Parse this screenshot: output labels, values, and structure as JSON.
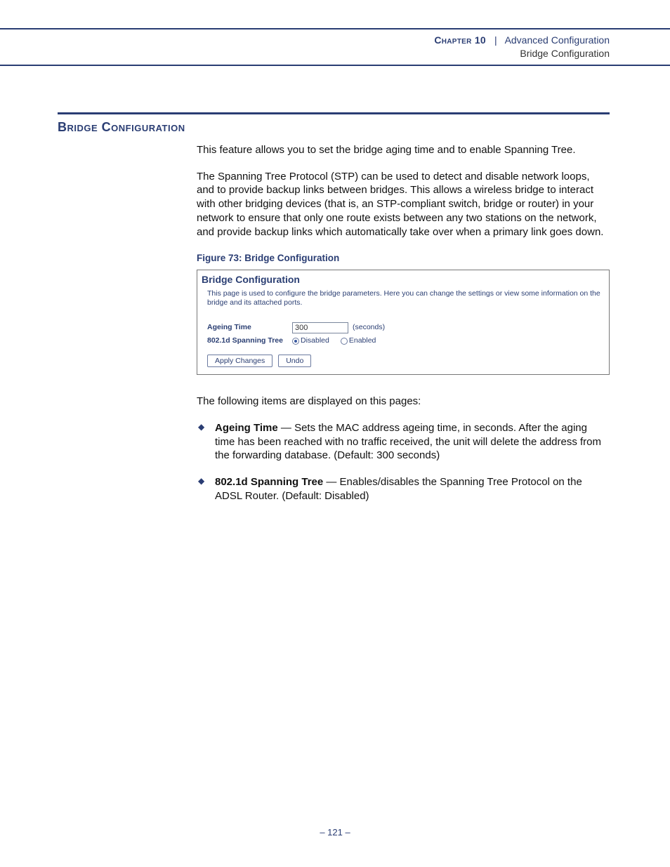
{
  "header": {
    "chapter_word": "Chapter",
    "chapter_num": "10",
    "separator": "|",
    "line1_tail": "Advanced Configuration",
    "line2": "Bridge Configuration"
  },
  "section": {
    "title": "Bridge Configuration",
    "para1": "This feature allows you to set the bridge aging time and to enable Spanning Tree.",
    "para2": "The Spanning Tree Protocol (STP) can be used to detect and disable network loops, and to provide backup links between bridges. This allows a wireless bridge to interact with other bridging devices (that is, an STP-compliant switch, bridge or router) in your network to ensure that only one route exists between any two stations on the network, and provide backup links which automatically take over when a primary link goes down.",
    "figure_caption": "Figure 73:  Bridge Configuration",
    "items_intro": "The following items are displayed on this pages:",
    "bullets": [
      {
        "term": "Ageing Time",
        "desc": " — Sets the MAC address ageing time, in seconds. After the aging time has been reached with no traffic received, the unit will delete the address from the forwarding database. (Default: 300 seconds)"
      },
      {
        "term": "802.1d Spanning Tree",
        "desc": " — Enables/disables the Spanning Tree Protocol on the ADSL Router. (Default: Disabled)"
      }
    ]
  },
  "figure": {
    "title": "Bridge Configuration",
    "desc": "This page is used to configure the bridge parameters. Here you can change the settings or view some information on the bridge and its attached ports.",
    "ageing_label": "Ageing Time",
    "ageing_value": "300",
    "ageing_unit": "(seconds)",
    "stp_label": "802.1d Spanning Tree",
    "radio_disabled": "Disabled",
    "radio_enabled": "Enabled",
    "btn_apply": "Apply Changes",
    "btn_undo": "Undo"
  },
  "footer": {
    "page_number": "–  121  –"
  }
}
